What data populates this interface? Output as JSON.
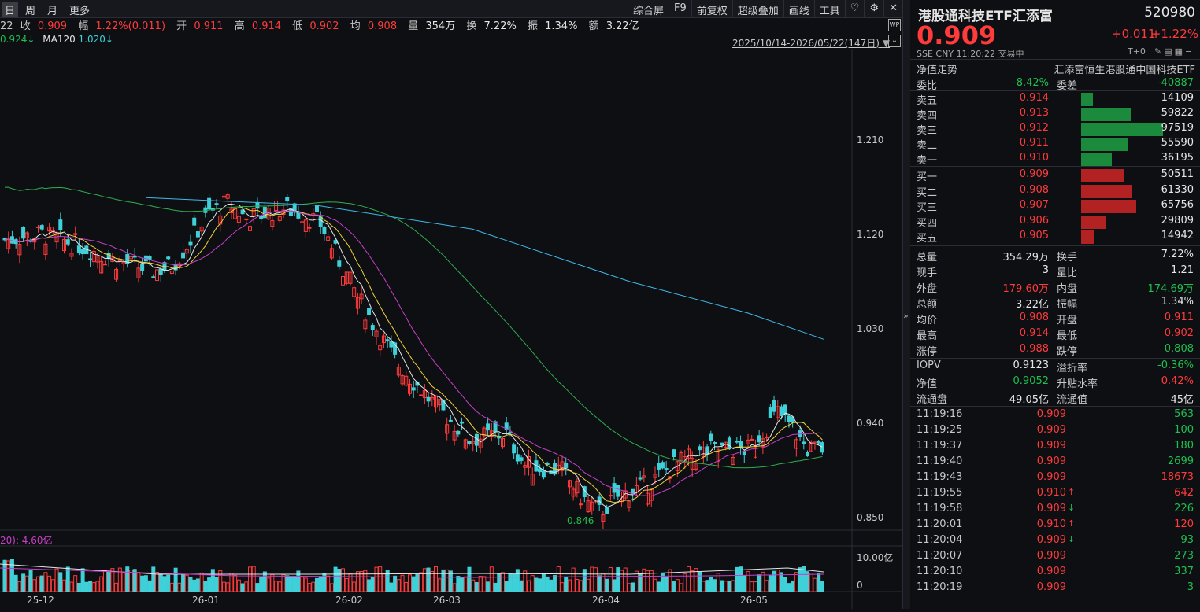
{
  "toolbar": {
    "left": [
      "日",
      "周",
      "月",
      "更多"
    ],
    "right": [
      "综合屏",
      "F9",
      "前复权",
      "超级叠加",
      "画线",
      "工具"
    ],
    "icons": [
      "heart-icon",
      "settings-icon",
      "close-icon"
    ]
  },
  "info": {
    "date_frag": "22",
    "close_label": "收",
    "close": "0.909",
    "amp_label": "幅",
    "amp": "1.22%(0.011)",
    "open_label": "开",
    "open": "0.911",
    "high_label": "高",
    "high": "0.914",
    "low_label": "低",
    "low": "0.902",
    "avg_label": "均",
    "avg": "0.908",
    "vol_label": "量",
    "vol": "354万",
    "turn_label": "换",
    "turn": "7.22%",
    "swing_label": "振",
    "swing": "1.34%",
    "amount_label": "额",
    "amount": "3.22亿"
  },
  "ma": {
    "frag": "0.924↓",
    "ma120_label": "MA120",
    "ma120": "1.020↓"
  },
  "date_range": "2025/10/14-2026/05/22(147日)",
  "chart": {
    "y_labels": [
      "1.210",
      "1.120",
      "1.030",
      "0.940",
      "0.850"
    ],
    "low_marker": "0.846",
    "vol_info": "20): 4.60亿",
    "vol_y_labels": [
      "10.00亿",
      "0"
    ],
    "x_labels": [
      "25-12",
      "26-01",
      "26-02",
      "26-03",
      "26-04",
      "26-05"
    ],
    "colors": {
      "up": "#ff3b3b",
      "down": "#3fd0d8",
      "ma5": "#e6e6e6",
      "ma10": "#f2d33b",
      "ma20": "#c640c6",
      "ma60": "#2fae4e",
      "ma120": "#3fb8e8"
    }
  },
  "quote": {
    "name": "港股通科技ETF汇添富",
    "code": "520980",
    "price": "0.909",
    "change": "+0.011",
    "change_pct": "+1.22%",
    "exchange": "SSE",
    "currency": "CNY",
    "time": "11:20:22",
    "status": "交易中",
    "tplus": "T+0",
    "nav_trend": "净值走势",
    "index_name": "汇添富恒生港股通中国科技ETF"
  },
  "order_book": {
    "weibi_label": "委比",
    "weibi": "-8.42%",
    "weicha_label": "委差",
    "weicha": "-40887",
    "asks": [
      {
        "label": "卖五",
        "price": "0.914",
        "vol": "14109",
        "ratio": 0.145
      },
      {
        "label": "卖四",
        "price": "0.913",
        "vol": "59822",
        "ratio": 0.614
      },
      {
        "label": "卖三",
        "price": "0.912",
        "vol": "97519",
        "ratio": 1.0
      },
      {
        "label": "卖二",
        "price": "0.911",
        "vol": "55590",
        "ratio": 0.57
      },
      {
        "label": "卖一",
        "price": "0.910",
        "vol": "36195",
        "ratio": 0.371
      }
    ],
    "bids": [
      {
        "label": "买一",
        "price": "0.909",
        "vol": "50511",
        "ratio": 0.518
      },
      {
        "label": "买二",
        "price": "0.908",
        "vol": "61330",
        "ratio": 0.629
      },
      {
        "label": "买三",
        "price": "0.907",
        "vol": "65756",
        "ratio": 0.674
      },
      {
        "label": "买四",
        "price": "0.906",
        "vol": "29809",
        "ratio": 0.306
      },
      {
        "label": "买五",
        "price": "0.905",
        "vol": "14942",
        "ratio": 0.153
      }
    ]
  },
  "stats": [
    {
      "l1": "总量",
      "v1": "354.29万",
      "c1": "white",
      "l2": "换手",
      "v2": "7.22%",
      "c2": "white"
    },
    {
      "l1": "现手",
      "v1": "3",
      "c1": "white",
      "l2": "量比",
      "v2": "1.21",
      "c2": "white"
    },
    {
      "l1": "外盘",
      "v1": "179.60万",
      "c1": "red",
      "l2": "内盘",
      "v2": "174.69万",
      "c2": "green"
    },
    {
      "l1": "总额",
      "v1": "3.22亿",
      "c1": "white",
      "l2": "振幅",
      "v2": "1.34%",
      "c2": "white"
    },
    {
      "l1": "均价",
      "v1": "0.908",
      "c1": "red",
      "l2": "开盘",
      "v2": "0.911",
      "c2": "red"
    },
    {
      "l1": "最高",
      "v1": "0.914",
      "c1": "red",
      "l2": "最低",
      "v2": "0.902",
      "c2": "red"
    },
    {
      "l1": "涨停",
      "v1": "0.988",
      "c1": "red",
      "l2": "跌停",
      "v2": "0.808",
      "c2": "green"
    }
  ],
  "stats2": [
    {
      "l1": "IOPV",
      "v1": "0.9123",
      "c1": "white",
      "l2": "溢折率",
      "v2": "-0.36%",
      "c2": "green"
    },
    {
      "l1": "净值",
      "v1": "0.9052",
      "c1": "green",
      "l2": "升贴水率",
      "v2": "0.42%",
      "c2": "red"
    },
    {
      "l1": "流通盘",
      "v1": "49.05亿",
      "c1": "white",
      "l2": "流通值",
      "v2": "45亿",
      "c2": "white"
    }
  ],
  "ticks": [
    {
      "time": "11:19:16",
      "price": "0.909",
      "arrow": "",
      "vol": "563",
      "vc": "green"
    },
    {
      "time": "11:19:25",
      "price": "0.909",
      "arrow": "",
      "vol": "100",
      "vc": "green"
    },
    {
      "time": "11:19:37",
      "price": "0.909",
      "arrow": "",
      "vol": "180",
      "vc": "green"
    },
    {
      "time": "11:19:40",
      "price": "0.909",
      "arrow": "",
      "vol": "2699",
      "vc": "green"
    },
    {
      "time": "11:19:43",
      "price": "0.909",
      "arrow": "",
      "vol": "18673",
      "vc": "red"
    },
    {
      "time": "11:19:55",
      "price": "0.910",
      "arrow": "↑",
      "vol": "642",
      "vc": "red"
    },
    {
      "time": "11:19:58",
      "price": "0.909",
      "arrow": "↓",
      "vol": "226",
      "vc": "green"
    },
    {
      "time": "11:20:01",
      "price": "0.910",
      "arrow": "↑",
      "vol": "120",
      "vc": "red"
    },
    {
      "time": "11:20:04",
      "price": "0.909",
      "arrow": "↓",
      "vol": "93",
      "vc": "green"
    },
    {
      "time": "11:20:07",
      "price": "0.909",
      "arrow": "",
      "vol": "273",
      "vc": "green"
    },
    {
      "time": "11:20:10",
      "price": "0.909",
      "arrow": "",
      "vol": "337",
      "vc": "green"
    },
    {
      "time": "11:20:19",
      "price": "0.909",
      "arrow": "",
      "vol": "3",
      "vc": "green"
    }
  ]
}
